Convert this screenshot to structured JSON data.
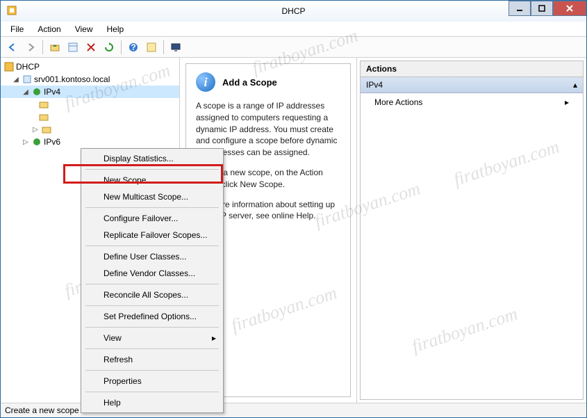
{
  "window": {
    "title": "DHCP"
  },
  "menubar": [
    "File",
    "Action",
    "View",
    "Help"
  ],
  "tree": {
    "root": "DHCP",
    "server": "srv001.kontoso.local",
    "ipv4": "IPv4",
    "ipv6": "IPv6"
  },
  "center": {
    "title": "Add a Scope",
    "p1": "A scope is a range of IP addresses assigned to computers requesting a dynamic IP address. You must create and configure a scope before dynamic IP addresses can be assigned.",
    "p2": "To add a new scope, on the Action menu, click New Scope.",
    "p3": "For more information about setting up a DHCP server, see online Help."
  },
  "actions": {
    "header": "Actions",
    "section": "IPv4",
    "more": "More Actions"
  },
  "context_menu": {
    "items": [
      "Display Statistics...",
      "New Scope...",
      "New Multicast Scope...",
      "Configure Failover...",
      "Replicate Failover Scopes...",
      "Define User Classes...",
      "Define Vendor Classes...",
      "Reconcile All Scopes...",
      "Set Predefined Options...",
      "View",
      "Refresh",
      "Properties",
      "Help"
    ]
  },
  "statusbar": "Create a new scope",
  "watermark": "firatboyan.com"
}
